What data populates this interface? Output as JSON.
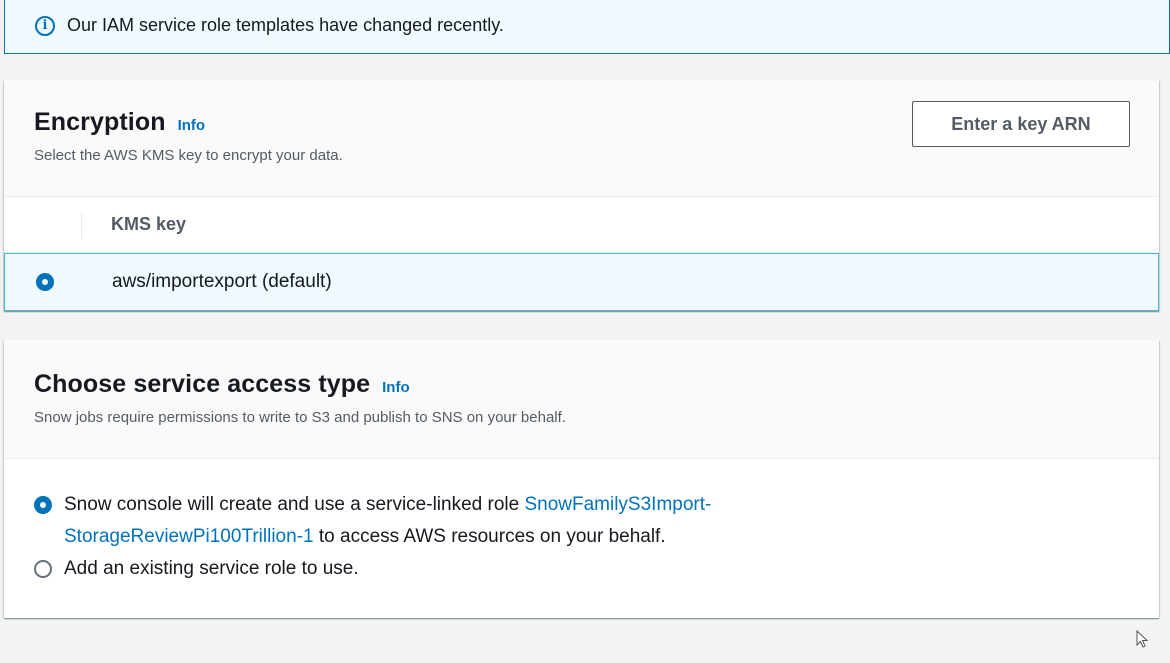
{
  "banner": {
    "text": "Our IAM service role templates have changed recently.",
    "icon": "info-icon"
  },
  "encryption": {
    "title": "Encryption",
    "info_label": "Info",
    "description": "Select the AWS KMS key to encrypt your data.",
    "enter_arn_button": "Enter a key ARN",
    "table": {
      "column_header": "KMS key",
      "rows": [
        {
          "value": "aws/importexport (default)",
          "selected": true
        }
      ]
    }
  },
  "service_access": {
    "title": "Choose service access type",
    "info_label": "Info",
    "description": "Snow jobs require permissions to write to S3 and publish to SNS on your behalf.",
    "options": [
      {
        "text_before": "Snow console will create and use a service-linked role ",
        "link_line1": "SnowFamilyS3Import-",
        "link_line2": "StorageReviewPi100Trillion-1",
        "text_after": " to access AWS resources on your behalf.",
        "selected": true
      },
      {
        "text": "Add an existing service role to use.",
        "selected": false
      }
    ]
  },
  "colors": {
    "accent": "#0073bb",
    "selected_row_bg": "#f1faff",
    "selected_row_border": "#44b9d6"
  }
}
